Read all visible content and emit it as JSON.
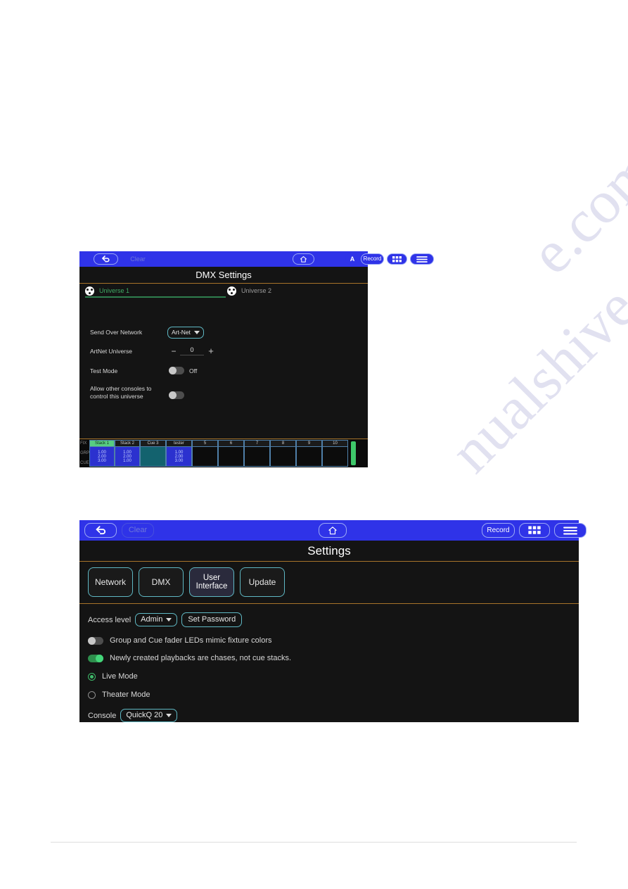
{
  "watermark": {
    "line1": "e.com",
    "line2": "nualshive"
  },
  "dmx_screen": {
    "toolbar": {
      "back_icon": "back-arrow-icon",
      "clear_label": "Clear",
      "home_icon": "home-icon",
      "fixture_icon": "A",
      "record_label": "Record",
      "grid_icon": "grid-icon",
      "menu_icon": "hamburger-menu-icon"
    },
    "title": "DMX Settings",
    "universe_tabs": [
      {
        "label": "Universe 1",
        "active": true
      },
      {
        "label": "Universe 2",
        "active": false
      }
    ],
    "settings": {
      "send_over_network_label": "Send Over Network",
      "send_over_network_value": "Art-Net",
      "artnet_universe_label": "ArtNet Universe",
      "artnet_universe_value": "0",
      "minus_label": "−",
      "plus_label": "+",
      "test_mode_label": "Test Mode",
      "test_mode_value": "Off",
      "test_mode_on": false,
      "allow_other_label": "Allow other consoles to control this universe",
      "allow_other_on": false
    },
    "faders": {
      "side_labels": [
        "FIX",
        "GRP",
        "CUE"
      ],
      "cells": [
        {
          "name": "Stack 1",
          "style": "green",
          "values": [
            "1.00",
            "2.00",
            "3.00"
          ]
        },
        {
          "name": "Stack 2",
          "style": "blue",
          "values": [
            "1.00",
            "2.00",
            "1.00"
          ]
        },
        {
          "name": "Cue 3",
          "style": "teal",
          "values": []
        },
        {
          "name": "tester",
          "style": "blue",
          "values": [
            "1.00",
            "2.00",
            "3.00"
          ]
        },
        {
          "name": "5",
          "style": "empty",
          "values": []
        },
        {
          "name": "6",
          "style": "empty",
          "values": []
        },
        {
          "name": "7",
          "style": "empty",
          "values": []
        },
        {
          "name": "8",
          "style": "empty",
          "values": []
        },
        {
          "name": "9",
          "style": "empty",
          "values": []
        },
        {
          "name": "10",
          "style": "empty",
          "values": []
        }
      ]
    }
  },
  "settings_screen": {
    "toolbar": {
      "back_icon": "back-arrow-icon",
      "clear_label": "Clear",
      "home_icon": "home-icon",
      "record_label": "Record",
      "grid_icon": "grid-icon",
      "menu_icon": "hamburger-menu-icon"
    },
    "title": "Settings",
    "tabs": [
      {
        "label": "Network",
        "active": false
      },
      {
        "label": "DMX",
        "active": false
      },
      {
        "label": "User Interface",
        "active": true
      },
      {
        "label": "Update",
        "active": false
      }
    ],
    "ui_settings": {
      "access_level_label": "Access level",
      "access_level_value": "Admin",
      "set_password_label": "Set Password",
      "mimic_colors_label": "Group and Cue fader LEDs mimic fixture colors",
      "mimic_colors_on": false,
      "chases_label": "Newly created playbacks are chases, not cue stacks.",
      "chases_on": true,
      "live_mode_label": "Live Mode",
      "live_mode_on": true,
      "theater_mode_label": "Theater Mode",
      "theater_mode_on": false,
      "console_label": "Console",
      "console_value": "QuickQ 20"
    }
  }
}
